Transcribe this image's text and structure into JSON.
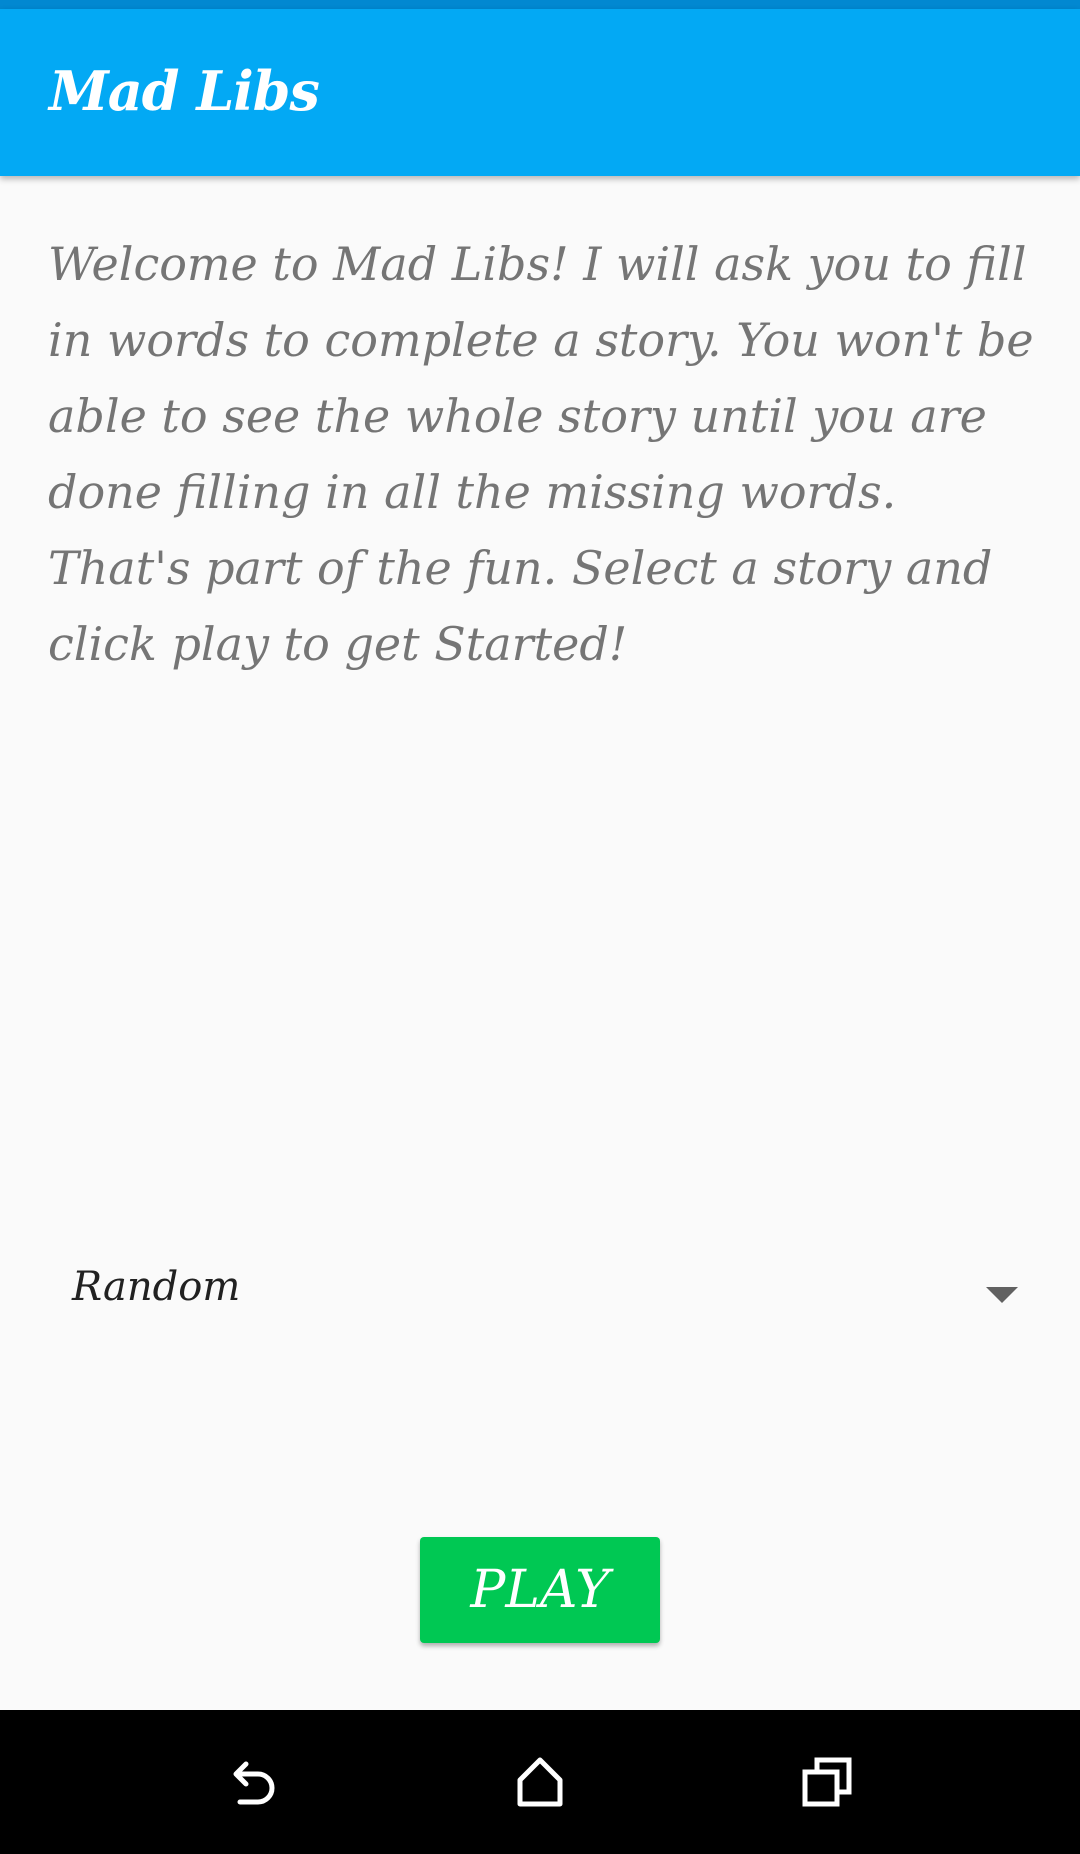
{
  "app_bar": {
    "title": "Mad Libs",
    "color": "#03A9F4",
    "status_bar_color": "#0288D1"
  },
  "intro": {
    "text": "Welcome to Mad Libs! I will ask you to fill in words to complete a story. You won't be able to see the whole story until you are done filling in all the missing words. That's part of the fun. Select a story and click play to get Started!"
  },
  "story_selector": {
    "selected": "Random",
    "icon": "dropdown-arrow-icon"
  },
  "play_button": {
    "label": "PLAY",
    "color": "#00C853"
  },
  "navigation": {
    "back_icon": "back-icon",
    "home_icon": "home-icon",
    "recents_icon": "recents-icon"
  }
}
